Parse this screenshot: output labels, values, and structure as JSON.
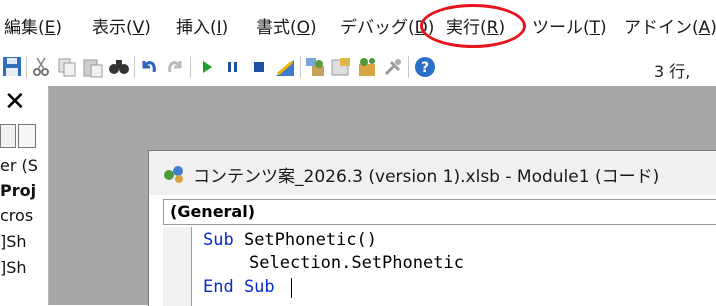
{
  "menubar": {
    "items": [
      {
        "label": "編集(",
        "key": "E",
        "tail": ")"
      },
      {
        "label": "表示(",
        "key": "V",
        "tail": ")"
      },
      {
        "label": "挿入(",
        "key": "I",
        "tail": ")"
      },
      {
        "label": "書式(",
        "key": "O",
        "tail": ")"
      },
      {
        "label": "デバッグ(",
        "key": "D",
        "tail": ")"
      },
      {
        "label": "実行(",
        "key": "R",
        "tail": ")"
      },
      {
        "label": "ツール(",
        "key": "T",
        "tail": ")"
      },
      {
        "label": "アドイン(",
        "key": "A",
        "tail": ")"
      }
    ],
    "highlight_color": "#e8141b"
  },
  "toolbar": {
    "icons": [
      "save-icon",
      "cut-icon",
      "copy-icon",
      "paste-icon",
      "find-icon",
      "undo-icon",
      "redo-icon",
      "run-icon",
      "break-icon",
      "reset-icon",
      "design-mode-icon",
      "project-explorer-icon",
      "properties-icon",
      "object-browser-icon",
      "toolbox-icon",
      "help-icon"
    ],
    "cursor_position": "3 行,"
  },
  "project_pane": {
    "close": "✕",
    "tree_lines": [
      "er (S",
      "Proj",
      "cros",
      "]Sh",
      "]Sh"
    ]
  },
  "code_window": {
    "title": "コンテンツ案_2026.3 (version 1).xlsb - Module1 (コード)",
    "object_combo": "(General)",
    "code": {
      "line1_kw": "Sub",
      "line1_rest": " SetPhonetic()",
      "line2": "Selection.SetPhonetic",
      "line3_kw": "End Sub"
    }
  },
  "colors": {
    "mdi_background": "#a7a7a7",
    "keyword": "#0a2bd1"
  }
}
